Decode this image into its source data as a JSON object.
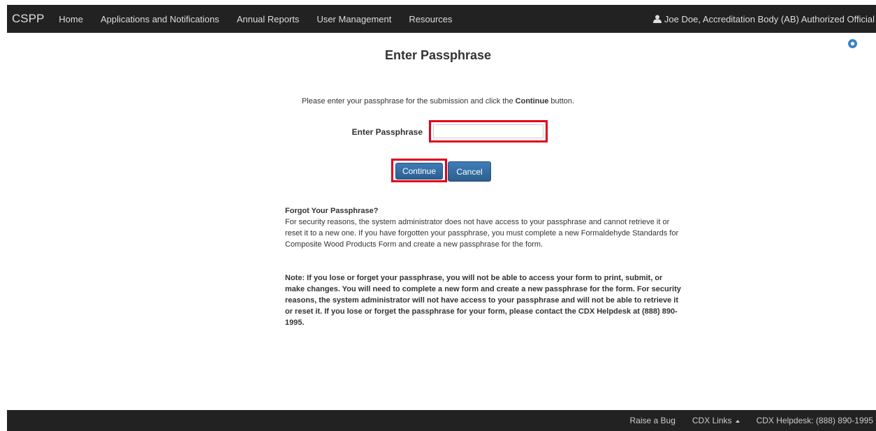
{
  "navbar": {
    "brand": "CSPP",
    "items": [
      {
        "label": "Home"
      },
      {
        "label": "Applications and Notifications"
      },
      {
        "label": "Annual Reports"
      },
      {
        "label": "User Management"
      },
      {
        "label": "Resources"
      }
    ],
    "user": {
      "icon": "user-icon",
      "label": "Joe Doe, Accreditation Body (AB) Authorized Official"
    }
  },
  "help": {
    "icon": "help-icon"
  },
  "main": {
    "title": "Enter Passphrase",
    "instruction_prefix": "Please enter your passphrase for the submission and click the ",
    "instruction_bold": "Continue",
    "instruction_suffix": " button.",
    "passphrase_label": "Enter Passphrase",
    "passphrase_value": "",
    "continue_label": "Continue",
    "cancel_label": "Cancel",
    "forgot_title": "Forgot Your Passphrase?",
    "forgot_text": "For security reasons, the system administrator does not have access to your passphrase and cannot retrieve it or reset it to a new one. If you have forgotten your passphrase, you must complete a new Formaldehyde Standards for Composite Wood Products Form and create a new passphrase for the form.",
    "note_text": "Note: If you lose or forget your passphrase, you will not be able to access your form to print, submit, or make changes. You will need to complete a new form and create a new passphrase for the form. For security reasons, the system administrator will not have access to your passphrase and will not be able to retrieve it or reset it. If you lose or forget the passphrase for your form, please contact the CDX Helpdesk at (888) 890-1995."
  },
  "footer": {
    "raise_bug": "Raise a Bug",
    "cdx_links": "CDX Links",
    "helpdesk": "CDX Helpdesk: (888) 890-1995"
  },
  "colors": {
    "navbar_bg": "#222222",
    "highlight": "#e0001b",
    "button": "#336699"
  }
}
